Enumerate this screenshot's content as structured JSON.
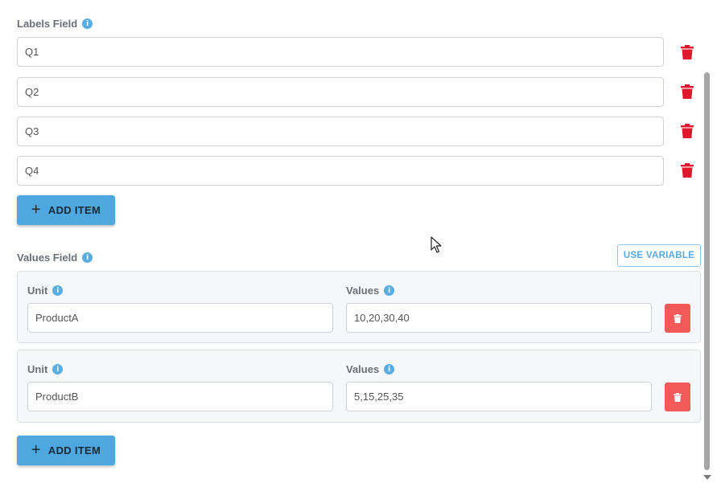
{
  "labels_field": {
    "title": "Labels Field",
    "items": [
      "Q1",
      "Q2",
      "Q3",
      "Q4"
    ],
    "add_button_label": "ADD ITEM"
  },
  "values_field": {
    "title": "Values Field",
    "use_variable_label": "USE VARIABLE",
    "unit_label": "Unit",
    "values_label": "Values",
    "items": [
      {
        "unit": "ProductA",
        "values": "10,20,30,40"
      },
      {
        "unit": "ProductB",
        "values": "5,15,25,35"
      }
    ],
    "add_button_label": "ADD ITEM"
  },
  "icons": {
    "info": "info-icon",
    "delete": "trash-icon",
    "add": "plus-icon"
  },
  "colors": {
    "accent": "#4ea8df",
    "delete_red": "#e0182d",
    "delete_card_red": "#f25a5a"
  }
}
